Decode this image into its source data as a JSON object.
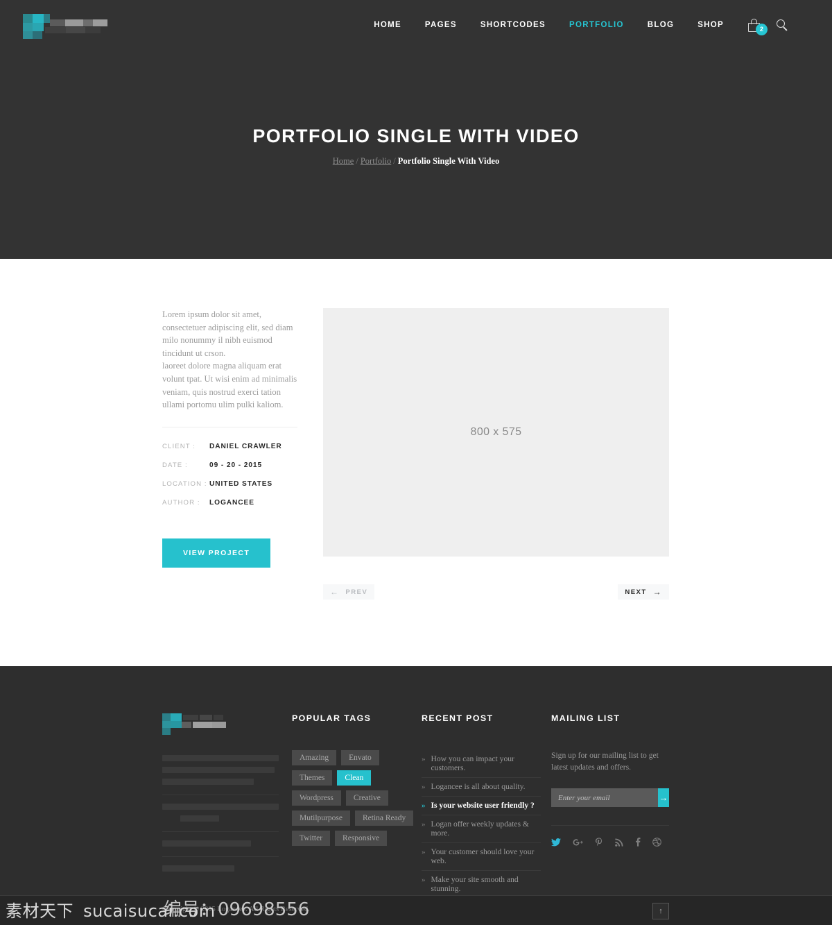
{
  "header": {
    "nav_items": [
      {
        "label": "HOME",
        "active": false
      },
      {
        "label": "PAGES",
        "active": false
      },
      {
        "label": "SHORTCODES",
        "active": false
      },
      {
        "label": "PORTFOLIO",
        "active": true
      },
      {
        "label": "BLOG",
        "active": false
      },
      {
        "label": "SHOP",
        "active": false
      }
    ],
    "cart_count": "2",
    "cart_icon": "shopping-bag-icon",
    "search_icon": "search-icon"
  },
  "hero": {
    "title": "PORTFOLIO SINGLE WITH VIDEO",
    "breadcrumb": {
      "home": "Home",
      "section": "Portfolio",
      "current": "Portfolio Single With Video",
      "separator": "/"
    }
  },
  "main": {
    "lede_paragraph_1": "Lorem ipsum dolor sit amet, consectetuer adipiscing elit, sed diam milo nonummy il nibh euismod tincidunt ut crson.",
    "lede_paragraph_2": "laoreet dolore magna aliquam erat volunt tpat. Ut wisi enim ad minimalis veniam, quis nostrud exerci tation ullami portomu ulim pulki kaliom.",
    "meta": [
      {
        "label": "CLIENT :",
        "value": "DANIEL CRAWLER"
      },
      {
        "label": "DATE :",
        "value": "09 - 20 - 2015"
      },
      {
        "label": "LOCATION :",
        "value": "UNITED STATES"
      },
      {
        "label": "AUTHOR :",
        "value": "LOGANCEE"
      }
    ],
    "view_project_label": "VIEW PROJECT",
    "media_placeholder": "800 x 575",
    "pager": {
      "prev_label": "PREV",
      "prev_arrow": "←",
      "next_label": "NEXT",
      "next_arrow": "→"
    }
  },
  "footer": {
    "tags_title": "POPULAR TAGS",
    "tags": [
      {
        "label": "Amazing",
        "active": false
      },
      {
        "label": "Envato",
        "active": false
      },
      {
        "label": "Themes",
        "active": false
      },
      {
        "label": "Clean",
        "active": true
      },
      {
        "label": "Wordpress",
        "active": false
      },
      {
        "label": "Creative",
        "active": false
      },
      {
        "label": "Mutilpurpose",
        "active": false
      },
      {
        "label": "Retina Ready",
        "active": false
      },
      {
        "label": "Twitter",
        "active": false
      },
      {
        "label": "Responsive",
        "active": false
      }
    ],
    "recent_title": "RECENT POST",
    "recent_posts": [
      {
        "label": "How you can impact your customers.",
        "active": false
      },
      {
        "label": "Logancee is all about quality.",
        "active": false
      },
      {
        "label": "Is your website user friendly ?",
        "active": true
      },
      {
        "label": "Logan offer weekly updates & more.",
        "active": false
      },
      {
        "label": "Your customer should love your web.",
        "active": false
      },
      {
        "label": "Make your site smooth and stunning.",
        "active": false
      }
    ],
    "post_chevron": "»",
    "mailing_title": "MAILING LIST",
    "mailing_text": "Sign up for our mailing list to get latest updates and offers.",
    "mailing_placeholder": "Enter your email",
    "mailing_value": "",
    "mailing_submit_arrow": "→",
    "social": [
      {
        "name": "twitter-icon",
        "glyph": "✓"
      },
      {
        "name": "google-plus-icon",
        "glyph": "g⁺"
      },
      {
        "name": "pinterest-icon",
        "glyph": "ᴘ"
      },
      {
        "name": "rss-icon",
        "glyph": "≋"
      },
      {
        "name": "facebook-icon",
        "glyph": "f"
      },
      {
        "name": "dribbble-icon",
        "glyph": "⊛"
      }
    ]
  },
  "bottom": {
    "copyright": "Copyright © 2015 Logancee. All Rights Reserved.",
    "to_top_arrow": "↑"
  },
  "watermark": {
    "brand_cn": "素材天下",
    "brand_url": "sucaisucai.com",
    "id_label": "编号：",
    "id_value": "09698556"
  },
  "colors": {
    "accent": "#26c1cd",
    "dark": "#333333",
    "footer": "#2e2e2e",
    "bottom": "#262626",
    "placeholder": "#efefef"
  }
}
